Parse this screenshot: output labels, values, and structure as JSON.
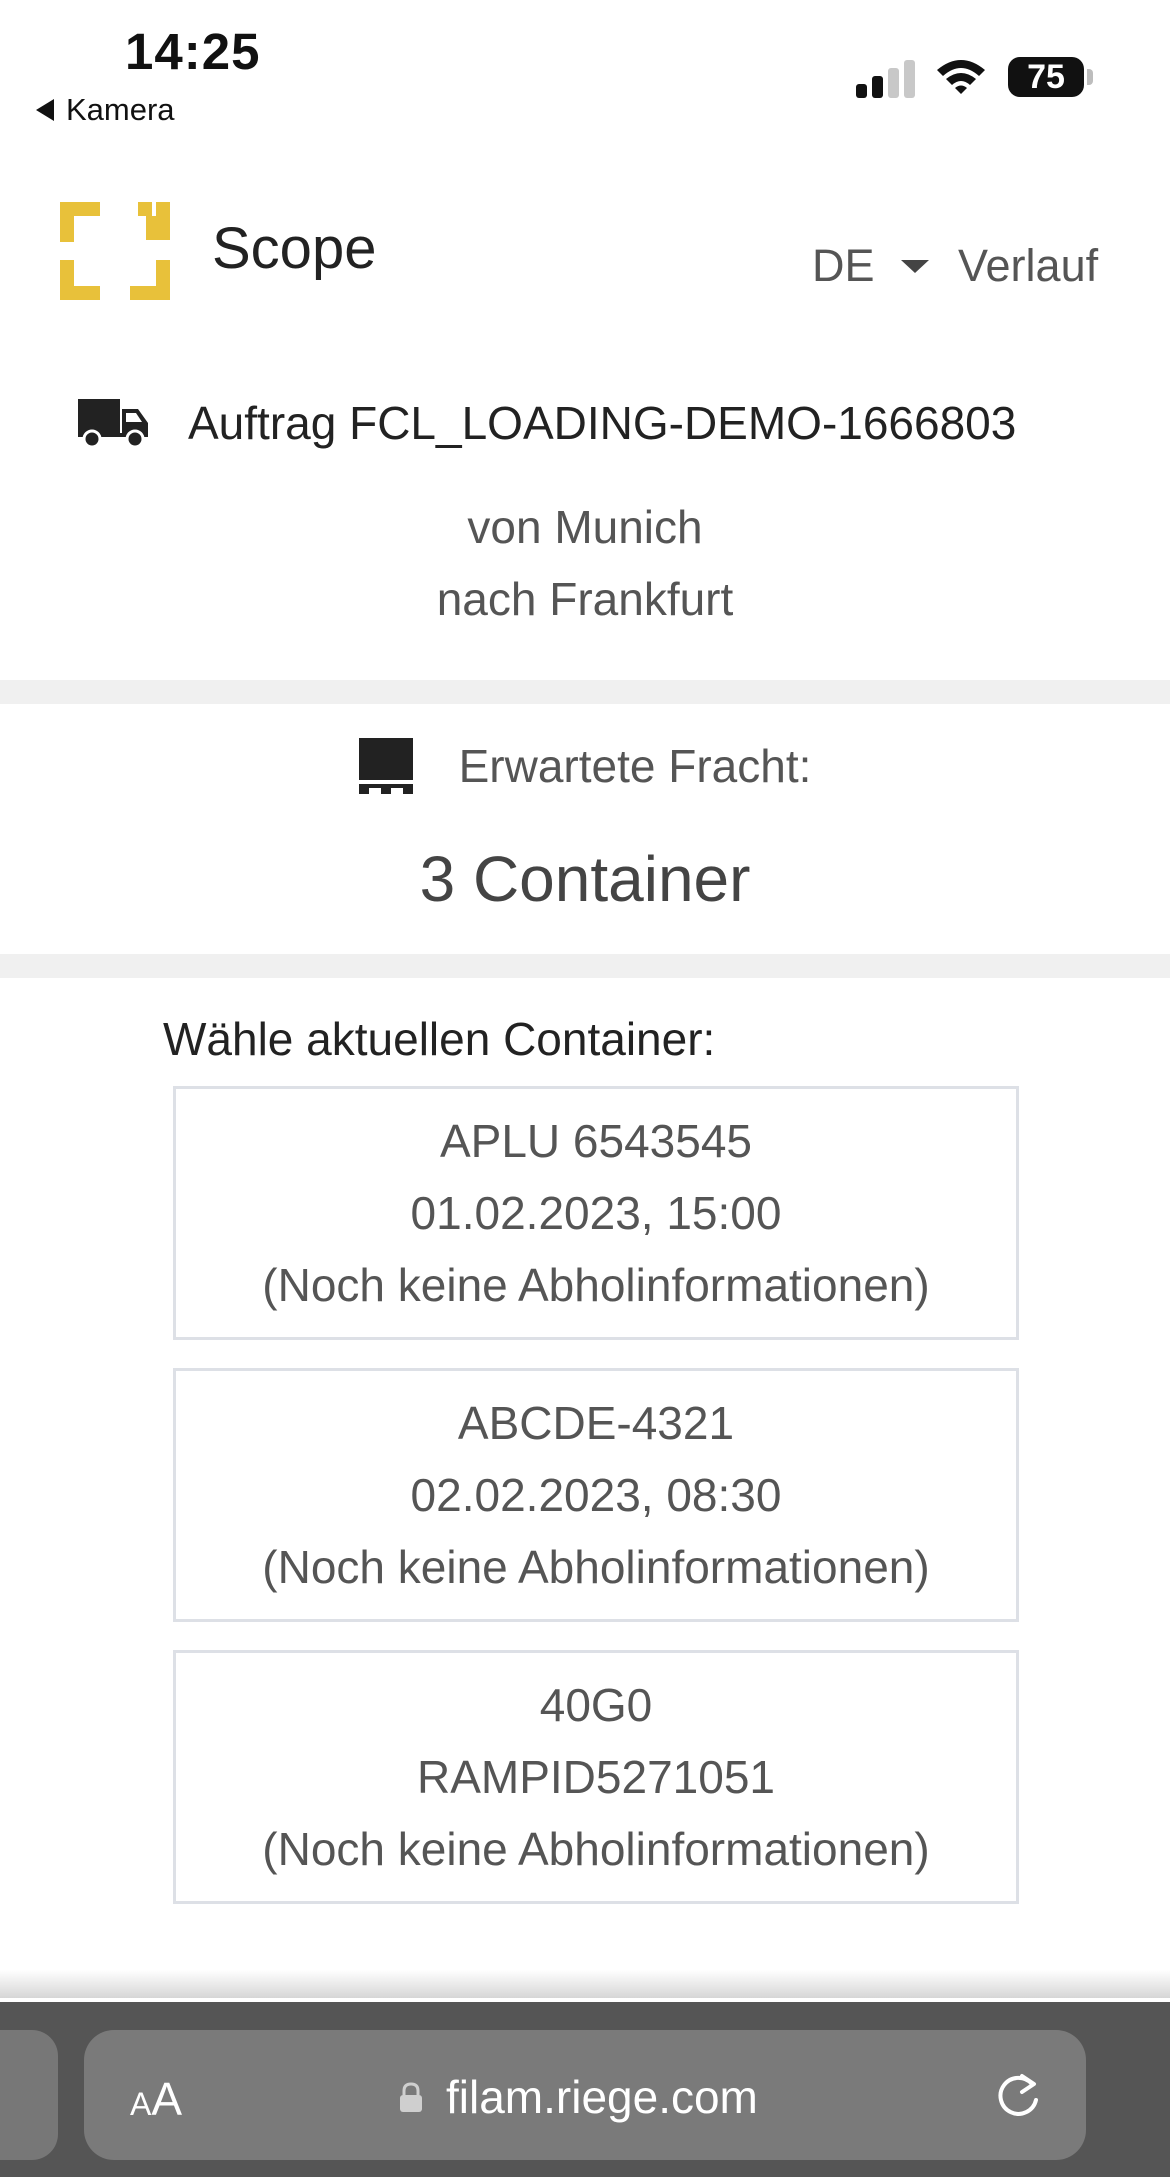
{
  "status_bar": {
    "time": "14:25",
    "back_label": "Kamera",
    "battery": "75"
  },
  "header": {
    "brand": "Scope",
    "language": "DE",
    "history": "Verlauf"
  },
  "order": {
    "title": "Auftrag FCL_LOADING-DEMO-1666803",
    "from": "von Munich",
    "to": "nach Frankfurt"
  },
  "freight": {
    "label": "Erwartete Fracht:",
    "count": "3 Container"
  },
  "containers": {
    "label": "Wähle aktuellen Container:",
    "items": [
      {
        "line1": "APLU 6543545",
        "line2": "01.02.2023, 15:00",
        "line3": "(Noch keine Abholinformationen)"
      },
      {
        "line1": "ABCDE-4321",
        "line2": "02.02.2023, 08:30",
        "line3": "(Noch keine Abholinformationen)"
      },
      {
        "line1": "40G0",
        "line2": "RAMPID5271051",
        "line3": "(Noch keine Abholinformationen)"
      }
    ]
  },
  "browser": {
    "text_size_button": "AA",
    "url": "filam.riege.com"
  },
  "colors": {
    "logo": "#E8C13A",
    "band": "#F0F0F0",
    "card_border": "#DDE0E6",
    "browser_bar": "#555555"
  },
  "icons": [
    "back-arrow-icon",
    "cellular-signal-icon",
    "wifi-icon",
    "battery-icon",
    "scope-logo",
    "caret-down-icon",
    "truck-icon",
    "pallet-icon",
    "lock-icon",
    "reload-icon"
  ]
}
